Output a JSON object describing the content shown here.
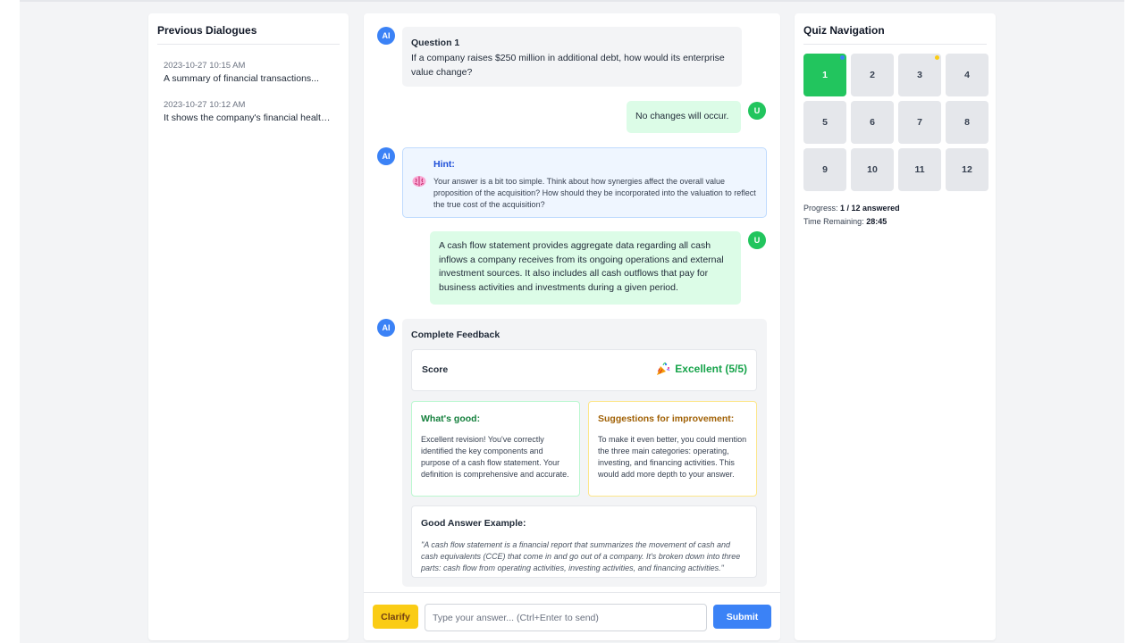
{
  "left": {
    "title": "Previous Dialogues",
    "dialogues": [
      {
        "timestamp": "2023-10-27 10:15 AM",
        "preview": "A summary of financial transactions..."
      },
      {
        "timestamp": "2023-10-27 10:12 AM",
        "preview": "It shows the company's financial health..."
      }
    ]
  },
  "chat": {
    "ai_avatar": "AI",
    "user_avatar": "U",
    "question_title": "Question 1",
    "question_text": "If a company raises $250 million in additional debt, how would its enterprise value change?",
    "user_answer_1": "No changes will occur.",
    "hint_title": "Hint:",
    "hint_text": "Your answer is a bit too simple. Think about how synergies affect the overall value proposition of the acquisition? How should they be incorporated into the valuation to reflect the true cost of the acquisition?",
    "hint_icon": "brain-icon",
    "user_answer_2": "A cash flow statement provides aggregate data regarding all cash inflows a company receives from its ongoing operations and external investment sources. It also includes all cash outflows that pay for business activities and investments during a given period.",
    "feedback": {
      "title": "Complete Feedback",
      "score_label": "Score",
      "score_icon": "party-popper-icon",
      "score_value": "Excellent (5/5)",
      "good_title": "What's good:",
      "good_text": "Excellent revision! You've correctly identified the key components and purpose of a cash flow statement. Your definition is comprehensive and accurate.",
      "suggestions_title": "Suggestions for improvement:",
      "suggestions_text": "To make it even better, you could mention the three main categories: operating, investing, and financing activities. This would add more depth to your answer.",
      "example_title": "Good Answer Example:",
      "example_text": "\"A cash flow statement is a financial report that summarizes the movement of cash and cash equivalents (CCE) that come in and go out of a company. It's broken down into three parts: cash flow from operating activities, investing activities, and financing activities.\""
    }
  },
  "input": {
    "clarify_label": "Clarify",
    "placeholder": "Type your answer... (Ctrl+Enter to send)",
    "value": "",
    "submit_label": "Submit"
  },
  "right": {
    "title": "Quiz Navigation",
    "questions": [
      "1",
      "2",
      "3",
      "4",
      "5",
      "6",
      "7",
      "8",
      "9",
      "10",
      "11",
      "12"
    ],
    "active_question": "1",
    "progress_label": "Progress:",
    "progress_value": "1 / 12 answered",
    "time_label": "Time Remaining:",
    "time_value": "28:45"
  },
  "colors": {
    "primary": "#3b82f6",
    "success": "#22c55e",
    "warning": "#facc15"
  }
}
